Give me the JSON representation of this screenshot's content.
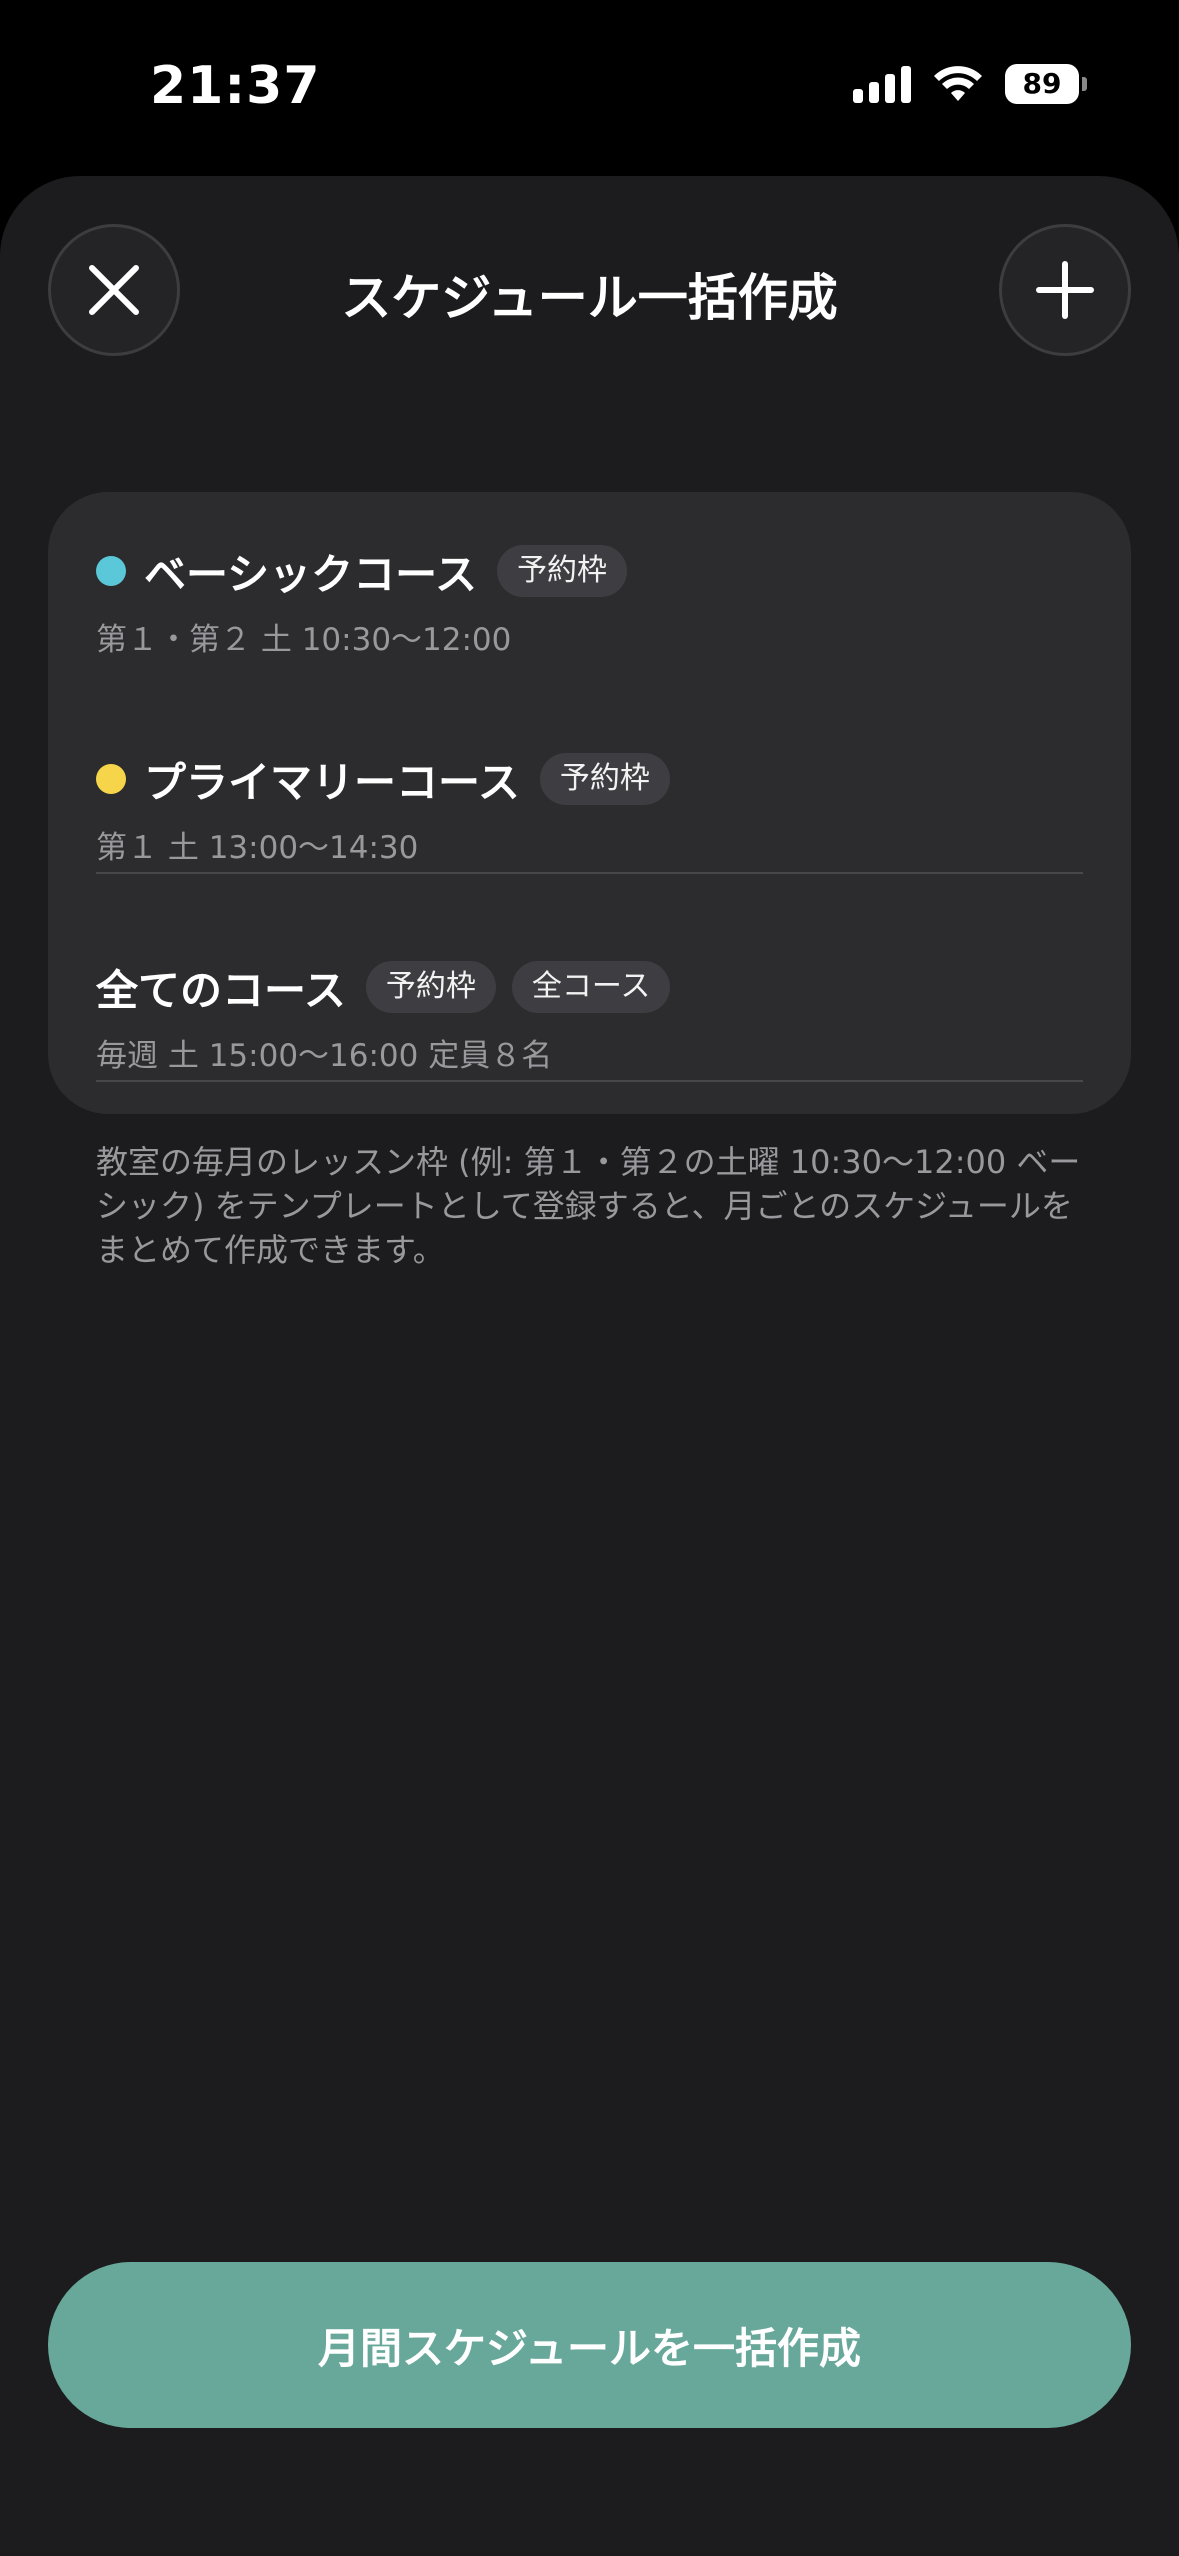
{
  "status_bar": {
    "time": "21:37",
    "battery": "89"
  },
  "header": {
    "title": "スケジュール一括作成",
    "close_icon": "close-icon",
    "add_icon": "plus-icon"
  },
  "templates": [
    {
      "name": "ベーシックコース",
      "dot_color": "#5ac8d8",
      "badges": [
        "予約枠"
      ],
      "schedule": "第１・第２ 土 10:30〜12:00"
    },
    {
      "name": "プライマリーコース",
      "dot_color": "#f7d54a",
      "badges": [
        "予約枠"
      ],
      "schedule": "第１ 土 13:00〜14:30"
    },
    {
      "name": "全てのコース",
      "dot_color": null,
      "badges": [
        "予約枠",
        "全コース"
      ],
      "schedule": "毎週 土 15:00〜16:00 定員８名"
    }
  ],
  "hint_text": "教室の毎月のレッスン枠 (例: 第１・第２の土曜 10:30〜12:00 ベーシック) をテンプレートとして登録すると、月ごとのスケジュールをまとめて作成できます。",
  "primary_button": {
    "label": "月間スケジュールを一括作成"
  },
  "colors": {
    "background": "#1c1c1e",
    "card": "#2c2c2e",
    "accent": "#68a89b"
  }
}
